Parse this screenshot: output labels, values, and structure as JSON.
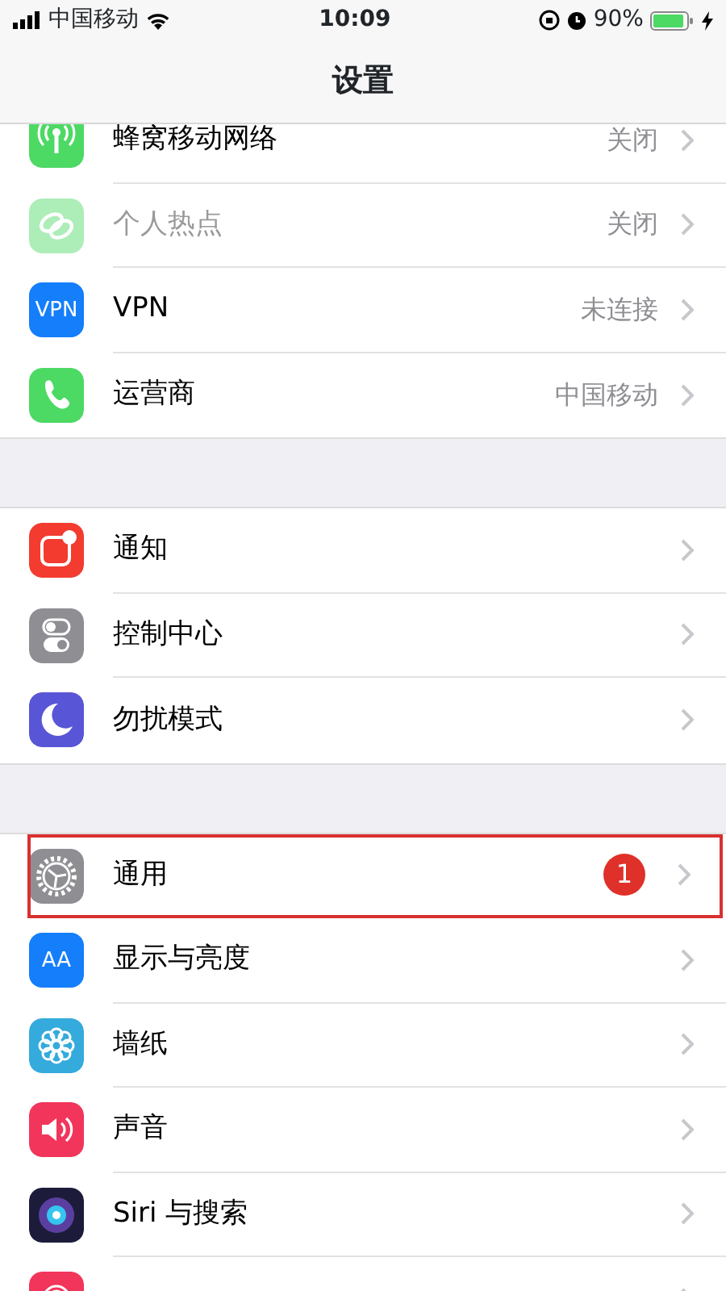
{
  "status_bar": {
    "carrier": "中国移动",
    "time": "10:09",
    "battery": "90%"
  },
  "nav": {
    "title": "设置"
  },
  "groups": [
    {
      "items": [
        {
          "label": "蜂窝移动网络",
          "value": "关闭",
          "disabled": false,
          "highlighted": false
        },
        {
          "label": "个人热点",
          "value": "关闭",
          "disabled": true,
          "highlighted": false
        },
        {
          "label": "VPN",
          "value": "未连接",
          "icon_text": "VPN",
          "disabled": false,
          "highlighted": false
        },
        {
          "label": "运营商",
          "value": "中国移动",
          "disabled": false,
          "highlighted": false
        }
      ]
    },
    {
      "items": [
        {
          "label": "通知",
          "disabled": false,
          "highlighted": false
        },
        {
          "label": "控制中心",
          "disabled": false,
          "highlighted": false
        },
        {
          "label": "勿扰模式",
          "disabled": false,
          "highlighted": false
        }
      ]
    },
    {
      "items": [
        {
          "label": "通用",
          "badge": "1",
          "disabled": false,
          "highlighted": true
        },
        {
          "label": "显示与亮度",
          "icon_text": "AA",
          "disabled": false,
          "highlighted": false
        },
        {
          "label": "墙纸",
          "disabled": false,
          "highlighted": false
        },
        {
          "label": "声音",
          "disabled": false,
          "highlighted": false
        },
        {
          "label": "Siri 与搜索",
          "disabled": false,
          "highlighted": false
        },
        {
          "disabled": false,
          "highlighted": false
        }
      ]
    }
  ]
}
